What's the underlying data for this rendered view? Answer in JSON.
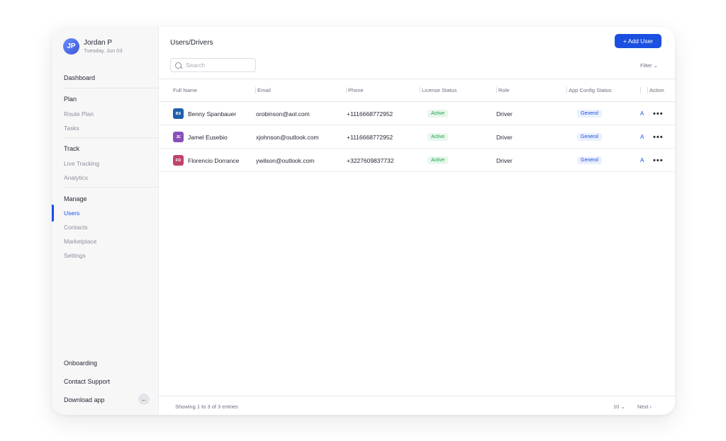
{
  "profile": {
    "initials": "JP",
    "name": "Jordan P",
    "date": "Tuesday, Jun 03"
  },
  "sidebar": {
    "dashboard": "Dashboard",
    "groups": [
      {
        "title": "Plan",
        "items": [
          "Route Plan",
          "Tasks"
        ]
      },
      {
        "title": "Track",
        "items": [
          "Live Tracking",
          "Analytics"
        ]
      },
      {
        "title": "Manage",
        "items": [
          "Users",
          "Contacts",
          "Marketplace",
          "Settings"
        ]
      }
    ],
    "active_item": "Users",
    "bottom": [
      "Onboarding",
      "Contact Support",
      "Download app"
    ],
    "collapse_icon": "arrow-left-icon"
  },
  "header": {
    "title": "Users/Drivers",
    "add_label": "+ Add User"
  },
  "search": {
    "placeholder": "Search",
    "value": ""
  },
  "filter": {
    "label": "Filter"
  },
  "table": {
    "columns": [
      "Full Name",
      "Email",
      "Phone",
      "License Status",
      "Role",
      "App Config Status",
      "Action"
    ],
    "rows": [
      {
        "initials": "BS",
        "avatar_color": "#1f5fa8",
        "name": "Benny Spanbauer",
        "email": "orobinson@aol.com",
        "phone": "+1116668772952",
        "license": "Active",
        "role": "Driver",
        "config": "Generol",
        "extra": "A"
      },
      {
        "initials": "JE",
        "avatar_color": "#8a4fb8",
        "name": "Jamel Eusebio",
        "email": "xjohnson@outlook.com",
        "phone": "+1116668772952",
        "license": "Active",
        "role": "Driver",
        "config": "Generol",
        "extra": "A"
      },
      {
        "initials": "FD",
        "avatar_color": "#c0446a",
        "name": "Florencio Dorrance",
        "email": "ywilson@outlook.com",
        "phone": "+3227609837732",
        "license": "Active",
        "role": "Driver",
        "config": "Generol",
        "extra": "A"
      }
    ]
  },
  "footer": {
    "showing": "Showing 1 to 3 of 3 entries",
    "page_size": "10",
    "next": "Next"
  },
  "colors": {
    "accent": "#1a4fe0",
    "active_green": "#1fa34a"
  }
}
